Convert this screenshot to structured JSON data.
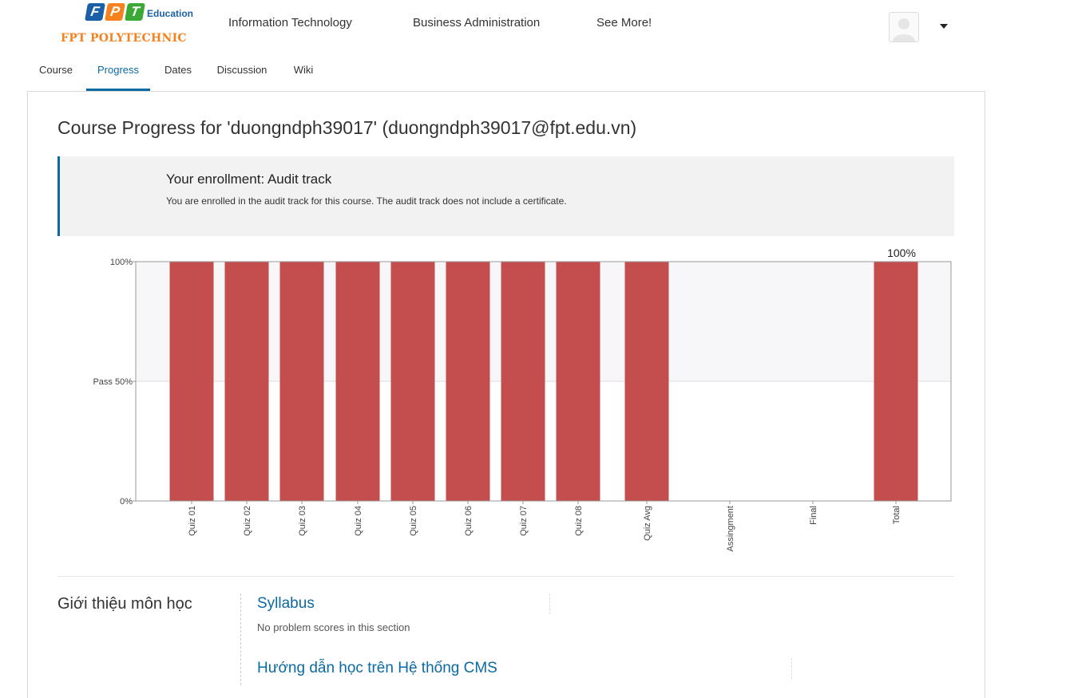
{
  "brand": {
    "logo_letters": [
      "F",
      "P",
      "T"
    ],
    "logo_colors": [
      "#1a5fa8",
      "#f5821f",
      "#3aa935"
    ],
    "education_label": "Education",
    "polytechnic_label": "FPT POLYTECHNIC",
    "polytechnic_color": "#f5821f"
  },
  "topnav": {
    "items": [
      {
        "label": "Information Technology"
      },
      {
        "label": "Business Administration"
      },
      {
        "label": "See More!"
      }
    ]
  },
  "tabs": [
    {
      "label": "Course",
      "active": false
    },
    {
      "label": "Progress",
      "active": true
    },
    {
      "label": "Dates",
      "active": false
    },
    {
      "label": "Discussion",
      "active": false
    },
    {
      "label": "Wiki",
      "active": false
    }
  ],
  "page": {
    "title": "Course Progress for 'duongndph39017' (duongndph39017@fpt.edu.vn)"
  },
  "enrollment": {
    "title": "Your enrollment: Audit track",
    "text": "You are enrolled in the audit track for this course. The audit track does not include a certificate."
  },
  "chart_data": {
    "type": "bar",
    "categories": [
      "Quiz 01",
      "Quiz 02",
      "Quiz 03",
      "Quiz 04",
      "Quiz 05",
      "Quiz 06",
      "Quiz 07",
      "Quiz 08",
      "Quiz Avg",
      "Assingment",
      "Final",
      "Total"
    ],
    "values": [
      100,
      100,
      100,
      100,
      100,
      100,
      100,
      100,
      100,
      0,
      0,
      100
    ],
    "y_ticks": [
      {
        "value": 0,
        "label": "0%"
      },
      {
        "value": 50,
        "label": "Pass 50%"
      },
      {
        "value": 100,
        "label": "100%"
      }
    ],
    "ylim": [
      0,
      100
    ],
    "pass_threshold": 50,
    "total_label": "100%",
    "bar_color": "#c44d4d",
    "pass_band_color": "#f7f7f9"
  },
  "sections": {
    "chapter_name": "Giới thiệu môn học",
    "subsections": [
      {
        "title": "Syllabus",
        "note": "No problem scores in this section"
      },
      {
        "title": "Hướng dẫn học trên Hệ thống CMS",
        "note": ""
      }
    ]
  },
  "colors": {
    "accent": "#0b6aa2"
  }
}
